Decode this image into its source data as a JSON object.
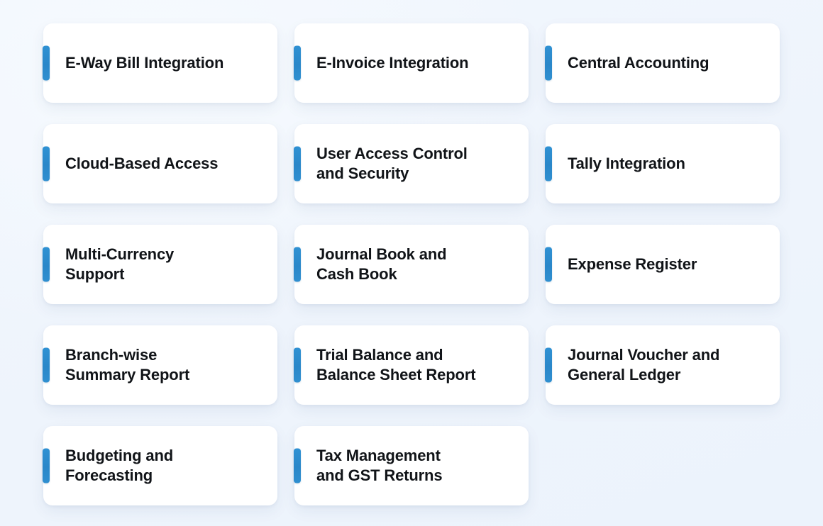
{
  "theme": {
    "page_background": "#eff5fd",
    "card_background": "#ffffff",
    "accent_color": "#2f8fd0",
    "text_color": "#111418"
  },
  "grid": {
    "columns": 3,
    "rows": 5,
    "cards": [
      {
        "label": "E-Way Bill Integration",
        "empty": false
      },
      {
        "label": "E-Invoice Integration",
        "empty": false
      },
      {
        "label": "Central Accounting",
        "empty": false
      },
      {
        "label": "Cloud-Based Access",
        "empty": false
      },
      {
        "label": "User Access Control\nand Security",
        "empty": false
      },
      {
        "label": "Tally Integration",
        "empty": false
      },
      {
        "label": "Multi-Currency\nSupport",
        "empty": false
      },
      {
        "label": "Journal Book and\nCash Book",
        "empty": false
      },
      {
        "label": "Expense Register",
        "empty": false
      },
      {
        "label": " Branch-wise\nSummary Report",
        "empty": false
      },
      {
        "label": "Trial Balance and\nBalance Sheet Report",
        "empty": false
      },
      {
        "label": "Journal Voucher and\nGeneral Ledger",
        "empty": false
      },
      {
        "label": "Budgeting and\nForecasting",
        "empty": false
      },
      {
        "label": "Tax Management\nand GST Returns",
        "empty": false
      },
      {
        "label": "",
        "empty": true
      }
    ]
  }
}
